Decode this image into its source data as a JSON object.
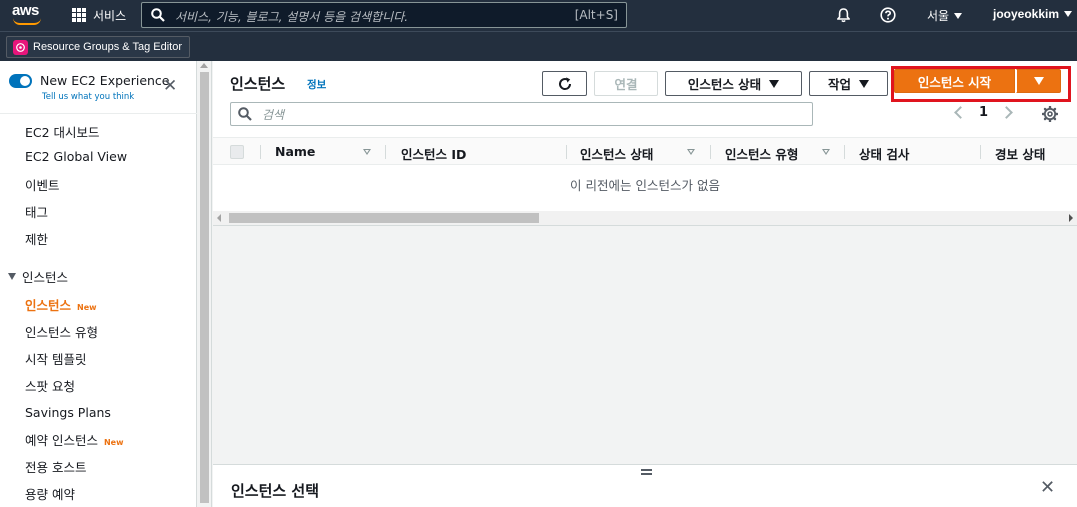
{
  "topnav": {
    "logo_text": "aws",
    "services_label": "서비스",
    "search_placeholder": "서비스, 기능, 블로그, 설명서 등을 검색합니다.",
    "search_shortcut": "[Alt+S]",
    "region_label": "서울",
    "user_label": "jooyeokkim"
  },
  "subbar": {
    "resource_groups_label": "Resource Groups & Tag Editor"
  },
  "sidebar": {
    "new_experience_title": "New EC2 Experience",
    "new_experience_link": "Tell us what you think",
    "top_links": [
      "EC2 대시보드",
      "EC2 Global View",
      "이벤트",
      "태그",
      "제한"
    ],
    "section_title": "인스턴스",
    "section_links": [
      {
        "label": "인스턴스",
        "badge": "New"
      },
      {
        "label": "인스턴스 유형",
        "badge": ""
      },
      {
        "label": "시작 템플릿",
        "badge": ""
      },
      {
        "label": "스팟 요청",
        "badge": ""
      },
      {
        "label": "Savings Plans",
        "badge": ""
      },
      {
        "label": "예약 인스턴스",
        "badge": "New"
      },
      {
        "label": "전용 호스트",
        "badge": ""
      },
      {
        "label": "용량 예약",
        "badge": ""
      }
    ]
  },
  "main": {
    "title": "인스턴스",
    "info_link": "정보",
    "connect_label": "연결",
    "instance_state_label": "인스턴스 상태",
    "actions_label": "작업",
    "launch_label": "인스턴스 시작",
    "filter_placeholder": "검색",
    "page_number": "1",
    "columns": [
      "Name",
      "인스턴스 ID",
      "인스턴스 상태",
      "인스턴스 유형",
      "상태 검사",
      "경보 상태"
    ],
    "empty_message": "이 리전에는 인스턴스가 없음"
  },
  "split_panel": {
    "title": "인스턴스 선택"
  },
  "colors": {
    "nav_bg": "#232f3e",
    "accent_orange": "#ec7211",
    "link_blue": "#0073bb",
    "highlight_red": "#e0141e"
  }
}
